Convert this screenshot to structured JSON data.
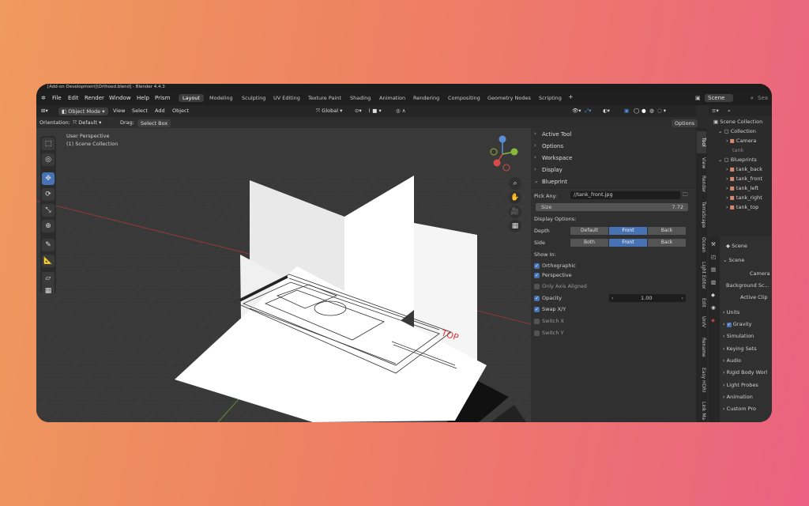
{
  "title": "[Add-on Development]\\Orthoed.blend] - Blender 4.4.3",
  "menu": [
    "File",
    "Edit",
    "Render",
    "Window",
    "Help",
    "Prism"
  ],
  "workspaces": [
    "Layout",
    "Modeling",
    "Sculpting",
    "UV Editing",
    "Texture Paint",
    "Shading",
    "Animation",
    "Rendering",
    "Compositing",
    "Geometry Nodes",
    "Scripting"
  ],
  "scene_field": "Scene",
  "search_placeholder": "Sea",
  "header": {
    "mode": "Object Mode",
    "view": "View",
    "select": "Select",
    "add": "Add",
    "object": "Object",
    "transform": "Global"
  },
  "header2": {
    "orientation_label": "Orientation:",
    "orientation": "Default",
    "drag_label": "Drag:",
    "drag": "Select Box",
    "options": "Options"
  },
  "viewport": {
    "perspective": "User Perspective",
    "collection": "(1) Scene Collection",
    "top_label": "TOP"
  },
  "npanel": {
    "sections": [
      "Active Tool",
      "Options",
      "Workspace",
      "Display",
      "Blueprint"
    ],
    "pick_label": "Pick Any:",
    "pick_value": "//tank_front.jpg",
    "size_label": "Size",
    "size_value": "7.72",
    "display_options": "Display Options:",
    "depth_label": "Depth",
    "depth": [
      "Default",
      "Front",
      "Back"
    ],
    "side_label": "Side",
    "side": [
      "Both",
      "Front",
      "Back"
    ],
    "show_in": "Show In:",
    "orthographic": "Orthographic",
    "perspective": "Perspective",
    "only_axis": "Only Axis Aligned",
    "opacity": "Opacity",
    "opacity_value": "1.00",
    "swap_xy": "Swap X/Y",
    "switch_x": "Switch X",
    "switch_y": "Switch Y"
  },
  "vtabs": [
    "Tool",
    "View",
    "Render",
    "TerraScape",
    "Ocean",
    "Light Editor",
    "Edit",
    "UnIV",
    "Rename",
    "Easy HDRI",
    "Link Ma"
  ],
  "outliner": {
    "root": "Scene Collection",
    "collection": "Collection",
    "camera": "Camera",
    "tank": "tank",
    "blueprints": "Blueprints",
    "items": [
      "tank_back",
      "tank_front",
      "tank_left",
      "tank_right",
      "tank_top"
    ]
  },
  "props": {
    "scene": "Scene",
    "scene_panel": "Scene",
    "camera": "Camera",
    "background": "Background Sc...",
    "active_clip": "Active Clip",
    "sections": [
      "Units",
      "Gravity",
      "Simulation",
      "Keying Sets",
      "Audio",
      "Rigid Body Worl",
      "Light Probes",
      "Animation",
      "Custom Pro"
    ]
  }
}
